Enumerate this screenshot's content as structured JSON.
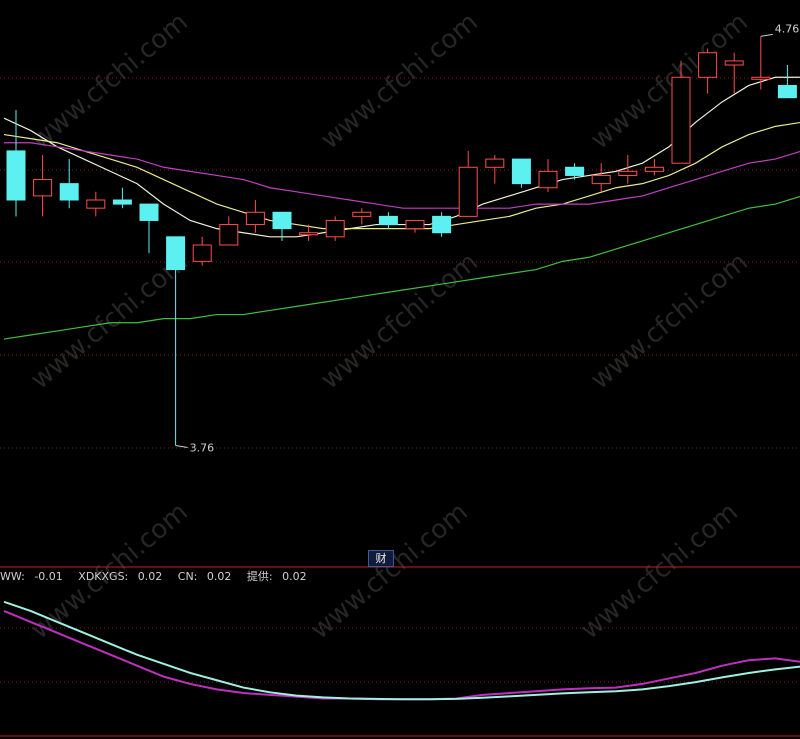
{
  "chart_data": [
    {
      "type": "candlestick",
      "y_axis": {
        "ylim": [
          3.7,
          4.8
        ]
      },
      "candles": [
        {
          "o": 4.48,
          "h": 4.58,
          "l": 4.32,
          "c": 4.36
        },
        {
          "o": 4.37,
          "h": 4.47,
          "l": 4.32,
          "c": 4.41
        },
        {
          "o": 4.4,
          "h": 4.46,
          "l": 4.34,
          "c": 4.36
        },
        {
          "o": 4.34,
          "h": 4.38,
          "l": 4.32,
          "c": 4.36
        },
        {
          "o": 4.36,
          "h": 4.39,
          "l": 4.34,
          "c": 4.35
        },
        {
          "o": 4.35,
          "h": 4.35,
          "l": 4.23,
          "c": 4.31
        },
        {
          "o": 4.27,
          "h": 4.27,
          "l": 3.76,
          "c": 4.19
        },
        {
          "o": 4.21,
          "h": 4.27,
          "l": 4.2,
          "c": 4.25
        },
        {
          "o": 4.25,
          "h": 4.32,
          "l": 4.25,
          "c": 4.3
        },
        {
          "o": 4.3,
          "h": 4.36,
          "l": 4.28,
          "c": 4.33
        },
        {
          "o": 4.33,
          "h": 4.33,
          "l": 4.26,
          "c": 4.29
        },
        {
          "o": 4.28,
          "h": 4.3,
          "l": 4.26,
          "c": 4.28
        },
        {
          "o": 4.27,
          "h": 4.32,
          "l": 4.26,
          "c": 4.31
        },
        {
          "o": 4.32,
          "h": 4.34,
          "l": 4.3,
          "c": 4.33
        },
        {
          "o": 4.32,
          "h": 4.33,
          "l": 4.29,
          "c": 4.3
        },
        {
          "o": 4.29,
          "h": 4.31,
          "l": 4.28,
          "c": 4.31
        },
        {
          "o": 4.32,
          "h": 4.33,
          "l": 4.27,
          "c": 4.28
        },
        {
          "o": 4.32,
          "h": 4.48,
          "l": 4.32,
          "c": 4.44
        },
        {
          "o": 4.44,
          "h": 4.47,
          "l": 4.4,
          "c": 4.46
        },
        {
          "o": 4.46,
          "h": 4.46,
          "l": 4.39,
          "c": 4.4
        },
        {
          "o": 4.39,
          "h": 4.46,
          "l": 4.38,
          "c": 4.43
        },
        {
          "o": 4.44,
          "h": 4.45,
          "l": 4.41,
          "c": 4.42
        },
        {
          "o": 4.4,
          "h": 4.45,
          "l": 4.38,
          "c": 4.42
        },
        {
          "o": 4.42,
          "h": 4.47,
          "l": 4.4,
          "c": 4.43
        },
        {
          "o": 4.43,
          "h": 4.46,
          "l": 4.42,
          "c": 4.44
        },
        {
          "o": 4.45,
          "h": 4.7,
          "l": 4.45,
          "c": 4.66
        },
        {
          "o": 4.66,
          "h": 4.73,
          "l": 4.62,
          "c": 4.72
        },
        {
          "o": 4.69,
          "h": 4.72,
          "l": 4.62,
          "c": 4.7
        },
        {
          "o": 4.66,
          "h": 4.76,
          "l": 4.63,
          "c": 4.66
        },
        {
          "o": 4.64,
          "h": 4.69,
          "l": 4.61,
          "c": 4.61
        },
        {
          "o": 4.55,
          "h": 4.57,
          "l": 4.5,
          "c": 4.5
        }
      ],
      "moving_averages": [
        {
          "color": "#f0f0d8",
          "values": [
            4.56,
            4.53,
            4.49,
            4.46,
            4.43,
            4.4,
            4.35,
            4.31,
            4.29,
            4.28,
            4.27,
            4.27,
            4.28,
            4.29,
            4.3,
            4.3,
            4.3,
            4.32,
            4.35,
            4.37,
            4.39,
            4.41,
            4.42,
            4.43,
            4.45,
            4.49,
            4.55,
            4.6,
            4.64,
            4.66,
            4.66
          ]
        },
        {
          "color": "#e8e890",
          "values": [
            4.52,
            4.51,
            4.5,
            4.48,
            4.46,
            4.44,
            4.41,
            4.38,
            4.35,
            4.33,
            4.31,
            4.3,
            4.29,
            4.29,
            4.29,
            4.29,
            4.29,
            4.3,
            4.31,
            4.32,
            4.34,
            4.35,
            4.37,
            4.39,
            4.4,
            4.42,
            4.45,
            4.49,
            4.52,
            4.54,
            4.55
          ]
        },
        {
          "color": "#c040c0",
          "values": [
            4.5,
            4.5,
            4.49,
            4.48,
            4.47,
            4.46,
            4.44,
            4.43,
            4.42,
            4.41,
            4.39,
            4.38,
            4.37,
            4.36,
            4.35,
            4.34,
            4.34,
            4.34,
            4.34,
            4.34,
            4.35,
            4.35,
            4.35,
            4.36,
            4.37,
            4.39,
            4.41,
            4.43,
            4.45,
            4.46,
            4.48
          ]
        },
        {
          "color": "#40c040",
          "values": [
            4.02,
            4.03,
            4.04,
            4.05,
            4.06,
            4.06,
            4.07,
            4.07,
            4.08,
            4.08,
            4.09,
            4.1,
            4.11,
            4.12,
            4.13,
            4.14,
            4.15,
            4.16,
            4.17,
            4.18,
            4.19,
            4.21,
            4.22,
            4.24,
            4.26,
            4.28,
            4.3,
            4.32,
            4.34,
            4.35,
            4.37
          ]
        }
      ],
      "annotations": [
        {
          "text": "3.76",
          "candle_index": 6
        },
        {
          "text": "4.76",
          "candle_index": 28
        }
      ]
    },
    {
      "type": "line",
      "legend": [
        {
          "label": "WW:",
          "value": "-0.01",
          "color": "#d0d0d0"
        },
        {
          "label": "XDKXGS:",
          "value": "0.02",
          "color": "#d0d0d0"
        },
        {
          "label": "CN:",
          "value": "0.02",
          "color": "#d0d0d0"
        },
        {
          "label": "提供:",
          "value": "0.02",
          "color": "#d0d0d0"
        }
      ],
      "ylim": [
        -0.12,
        0.25
      ],
      "series": [
        {
          "color": "#c030c0",
          "values": [
            0.22,
            0.19,
            0.16,
            0.13,
            0.1,
            0.07,
            0.04,
            0.02,
            0.005,
            -0.005,
            -0.01,
            -0.015,
            -0.02,
            -0.02,
            -0.022,
            -0.022,
            -0.022,
            -0.02,
            -0.01,
            -0.005,
            0.0,
            0.005,
            0.008,
            0.01,
            0.02,
            0.035,
            0.05,
            0.07,
            0.085,
            0.09,
            0.08
          ]
        },
        {
          "color": "#a0f0e0",
          "values": [
            0.245,
            0.22,
            0.19,
            0.16,
            0.13,
            0.1,
            0.075,
            0.05,
            0.03,
            0.01,
            -0.003,
            -0.012,
            -0.017,
            -0.02,
            -0.021,
            -0.022,
            -0.022,
            -0.021,
            -0.018,
            -0.014,
            -0.01,
            -0.006,
            -0.003,
            0.0,
            0.005,
            0.014,
            0.025,
            0.038,
            0.05,
            0.06,
            0.068
          ]
        }
      ],
      "signal_badge": "财"
    }
  ],
  "watermark": "www.cfchi.com",
  "colors": {
    "up": "#ff4d4d",
    "down": "#5cf0f0",
    "grid": "#802020",
    "divider": "#c02020"
  }
}
